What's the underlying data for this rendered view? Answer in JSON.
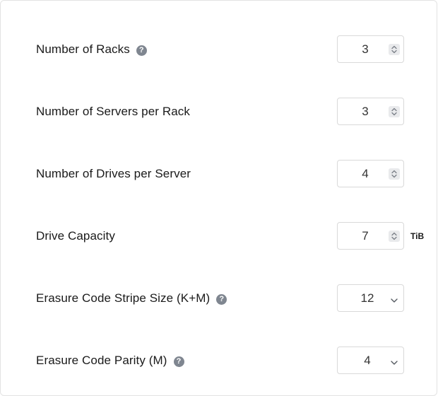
{
  "fields": [
    {
      "label": "Number of Racks",
      "value": "3",
      "help": true,
      "help_glyph": "?",
      "control": "stepper"
    },
    {
      "label": "Number of Servers per Rack",
      "value": "3",
      "help": false,
      "control": "stepper"
    },
    {
      "label": "Number of Drives per Server",
      "value": "4",
      "help": false,
      "control": "stepper"
    },
    {
      "label": "Drive Capacity",
      "value": "7",
      "help": false,
      "control": "stepper",
      "unit": "TiB"
    },
    {
      "label": "Erasure Code Stripe Size (K+M)",
      "value": "12",
      "help": true,
      "help_glyph": "?",
      "control": "select"
    },
    {
      "label": "Erasure Code Parity (M)",
      "value": "4",
      "help": true,
      "help_glyph": "?",
      "control": "select"
    }
  ],
  "icons": {
    "help": "question-circle-icon",
    "stepper": "up-down-arrows-icon",
    "select": "chevron-down-icon"
  },
  "colors": {
    "help_icon": "#7f8690",
    "border": "#d9d9d9",
    "stepper_bg": "#e9eaec"
  }
}
